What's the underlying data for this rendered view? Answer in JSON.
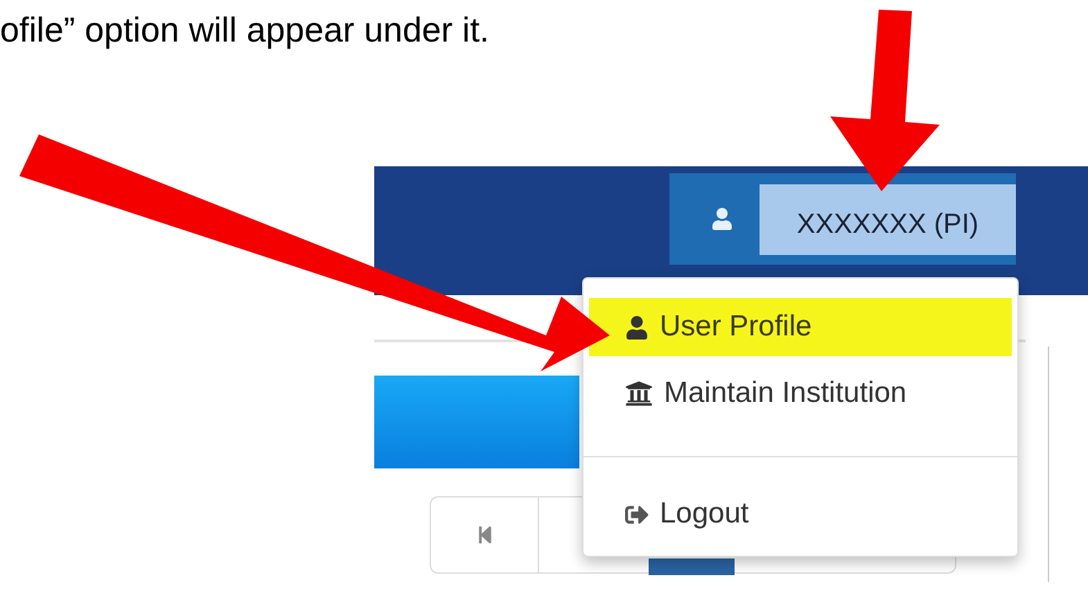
{
  "document": {
    "text": "ofile” option will appear under it."
  },
  "screenshot": {
    "user_button": {
      "label": "XXXXXXX (PI)"
    },
    "menu": {
      "items": [
        {
          "label": "User Profile",
          "kind": "profile",
          "highlighted": true,
          "divider_before": false
        },
        {
          "label": "Maintain Institution",
          "kind": "institution",
          "highlighted": false,
          "divider_before": false
        },
        {
          "label": "Logout",
          "kind": "logout",
          "highlighted": false,
          "divider_before": true
        }
      ]
    }
  }
}
